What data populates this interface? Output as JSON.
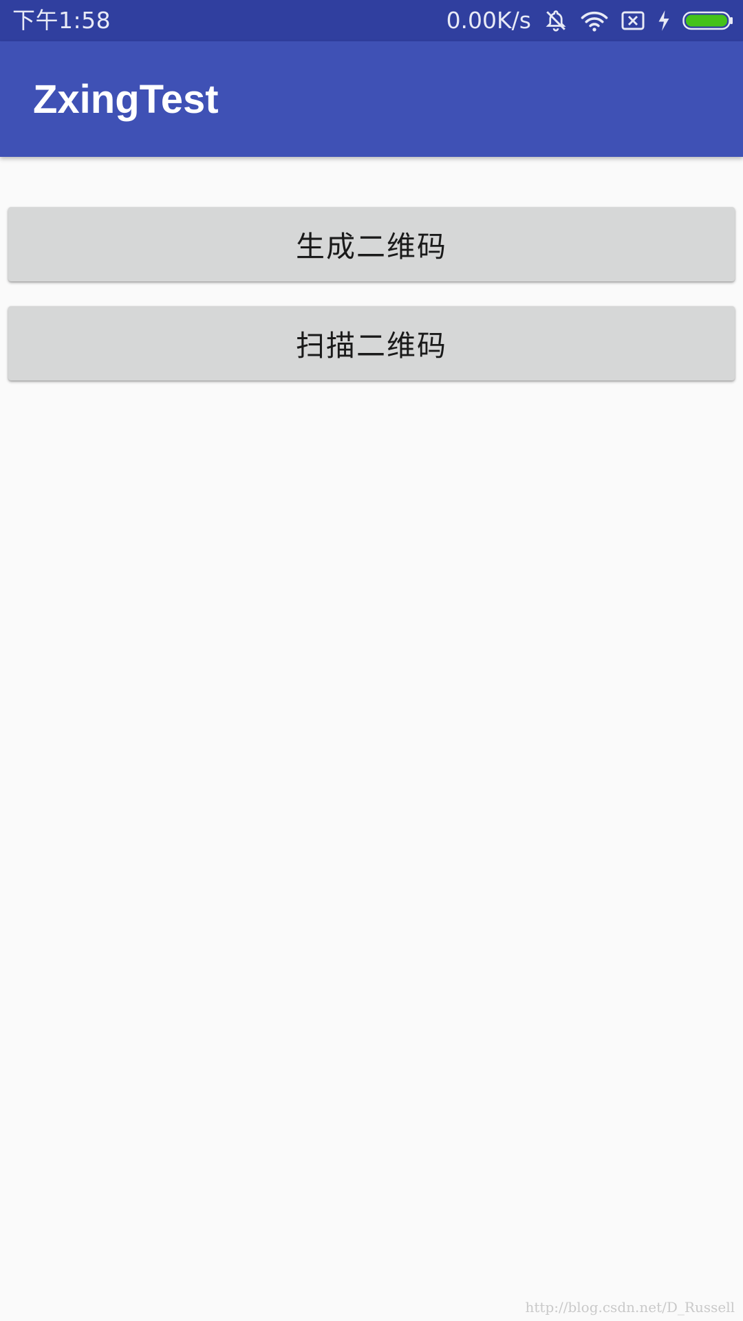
{
  "status_bar": {
    "time": "下午1:58",
    "net_speed": "0.00K/s",
    "icons": [
      "mute-bell-icon",
      "wifi-icon",
      "no-sim-icon",
      "charging-icon",
      "battery-icon"
    ],
    "battery_level": 1.0,
    "battery_color": "#44c21a"
  },
  "app_bar": {
    "title": "ZxingTest",
    "color": "#3f51b5"
  },
  "main": {
    "generate_label": "生成二维码",
    "scan_label": "扫描二维码"
  },
  "watermark": {
    "text": "http://blog.csdn.net/D_Russell"
  }
}
